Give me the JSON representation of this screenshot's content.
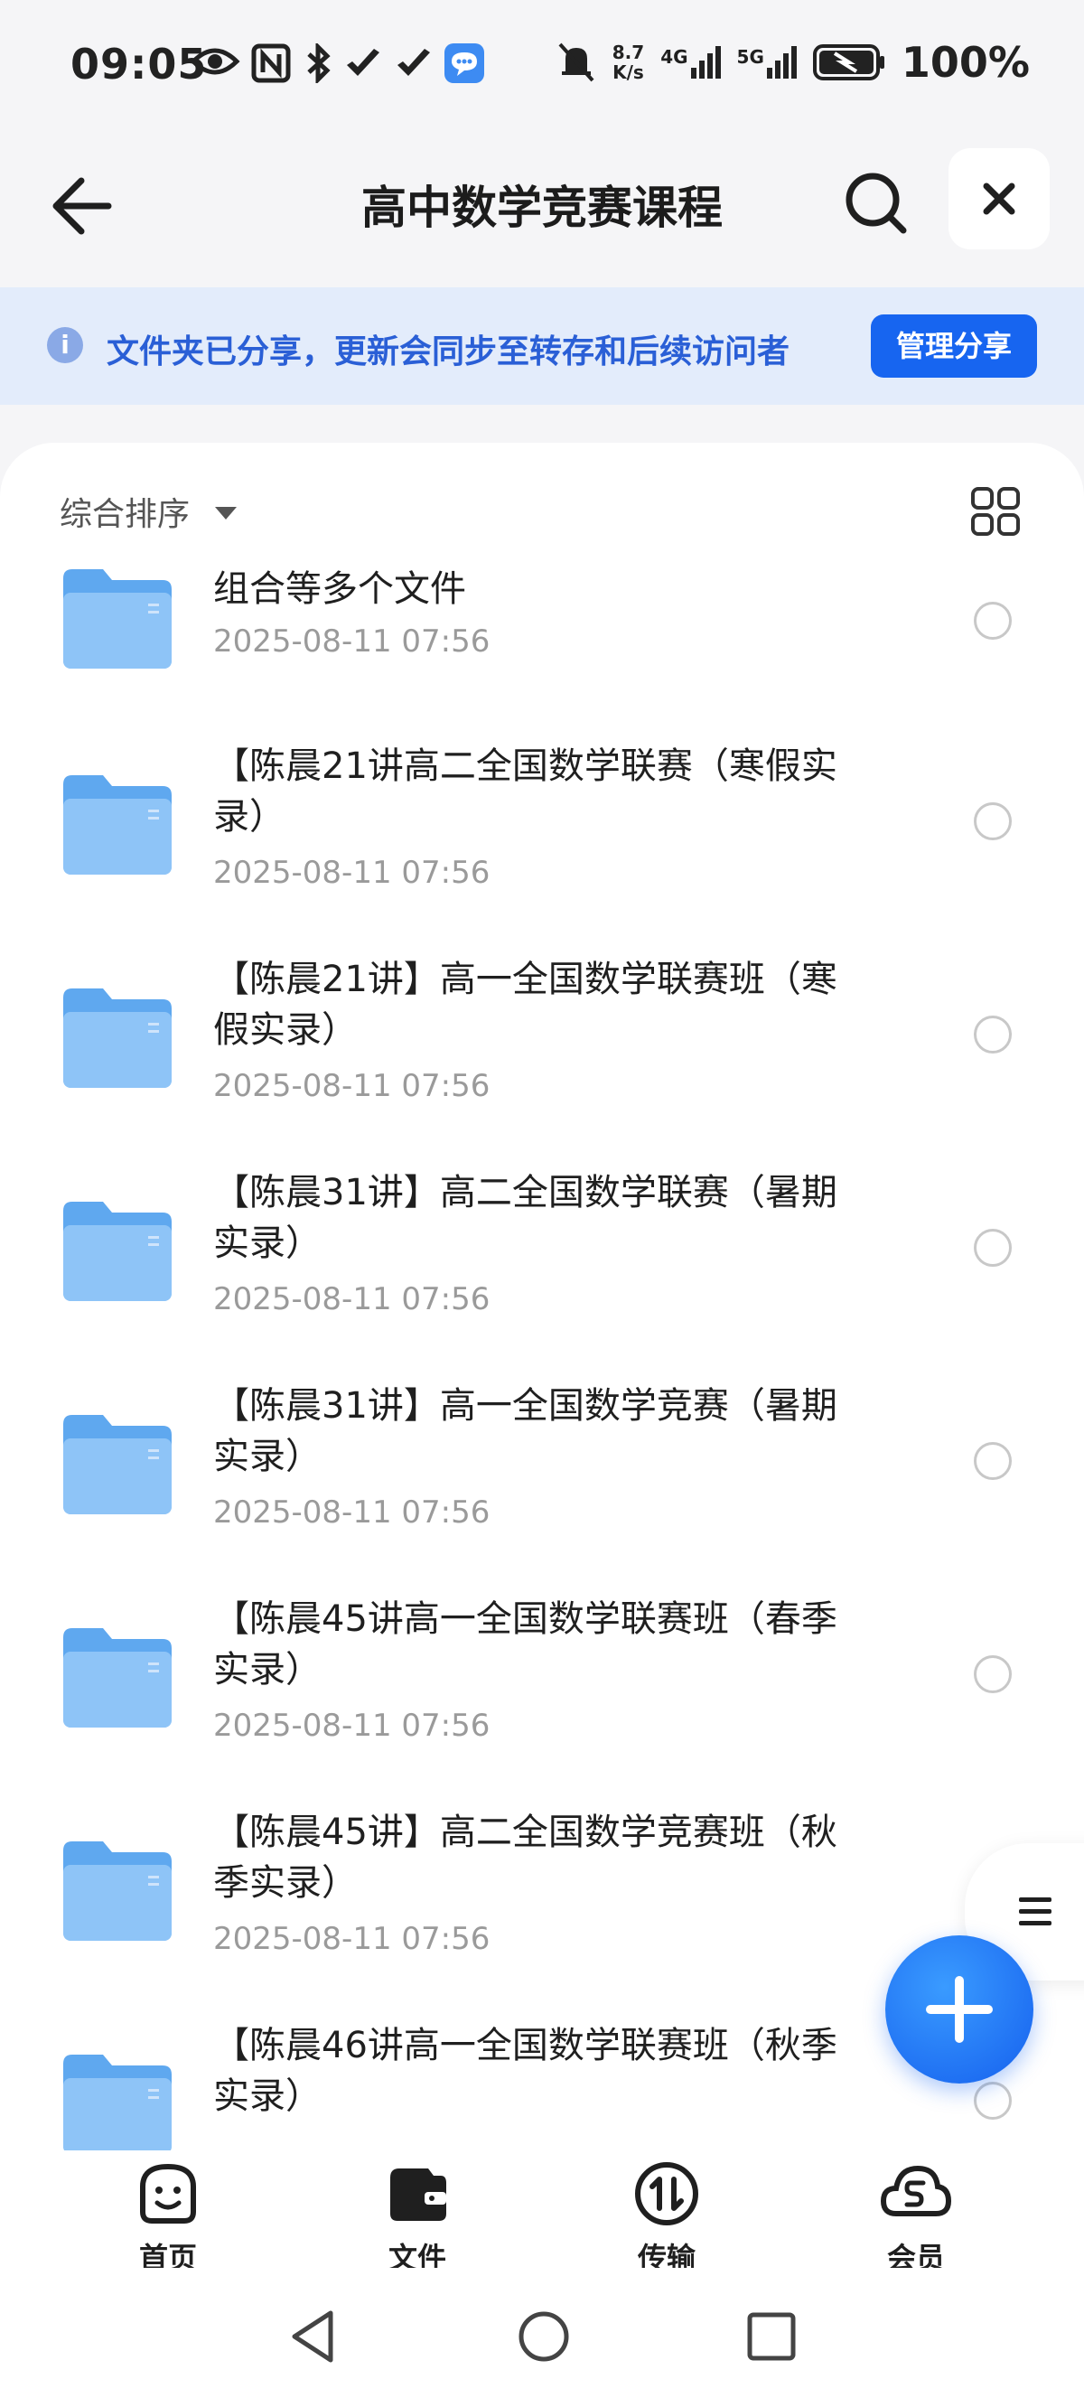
{
  "status_bar": {
    "time": "09:05",
    "speed_value": "8.7",
    "speed_unit": "K/s",
    "net1": "4G",
    "net2": "5G",
    "battery": "100%"
  },
  "header": {
    "title": "高中数学竞赛课程"
  },
  "banner": {
    "message": "文件夹已分享，更新会同步至转存和后续访问者",
    "manage_label": "管理分享"
  },
  "sort": {
    "label": "综合排序"
  },
  "files": [
    {
      "name": "组合等多个文件",
      "date": "2025-08-11 07:56"
    },
    {
      "name": "【陈晨21讲高二全国数学联赛（寒假实录）",
      "date": "2025-08-11 07:56"
    },
    {
      "name": "【陈晨21讲】高一全国数学联赛班（寒假实录）",
      "date": "2025-08-11 07:56"
    },
    {
      "name": "【陈晨31讲】高二全国数学联赛（暑期实录）",
      "date": "2025-08-11 07:56"
    },
    {
      "name": "【陈晨31讲】高一全国数学竞赛（暑期实录）",
      "date": "2025-08-11 07:56"
    },
    {
      "name": "【陈晨45讲高一全国数学联赛班（春季实录）",
      "date": "2025-08-11 07:56"
    },
    {
      "name": "【陈晨45讲】高二全国数学竞赛班（秋季实录）",
      "date": "2025-08-11 07:56"
    },
    {
      "name": "【陈晨46讲高一全国数学联赛班（秋季实录）",
      "date": ""
    }
  ],
  "nav": [
    {
      "label": "首页",
      "icon": "home-face-icon"
    },
    {
      "label": "文件",
      "icon": "files-wallet-icon"
    },
    {
      "label": "传输",
      "icon": "transfer-icon"
    },
    {
      "label": "会员",
      "icon": "member-cloud-icon"
    }
  ],
  "colors": {
    "accent": "#1765f0",
    "banner_bg": "#e3ecfb",
    "banner_text": "#2a5fd6",
    "folder": "#6fb1f3"
  }
}
